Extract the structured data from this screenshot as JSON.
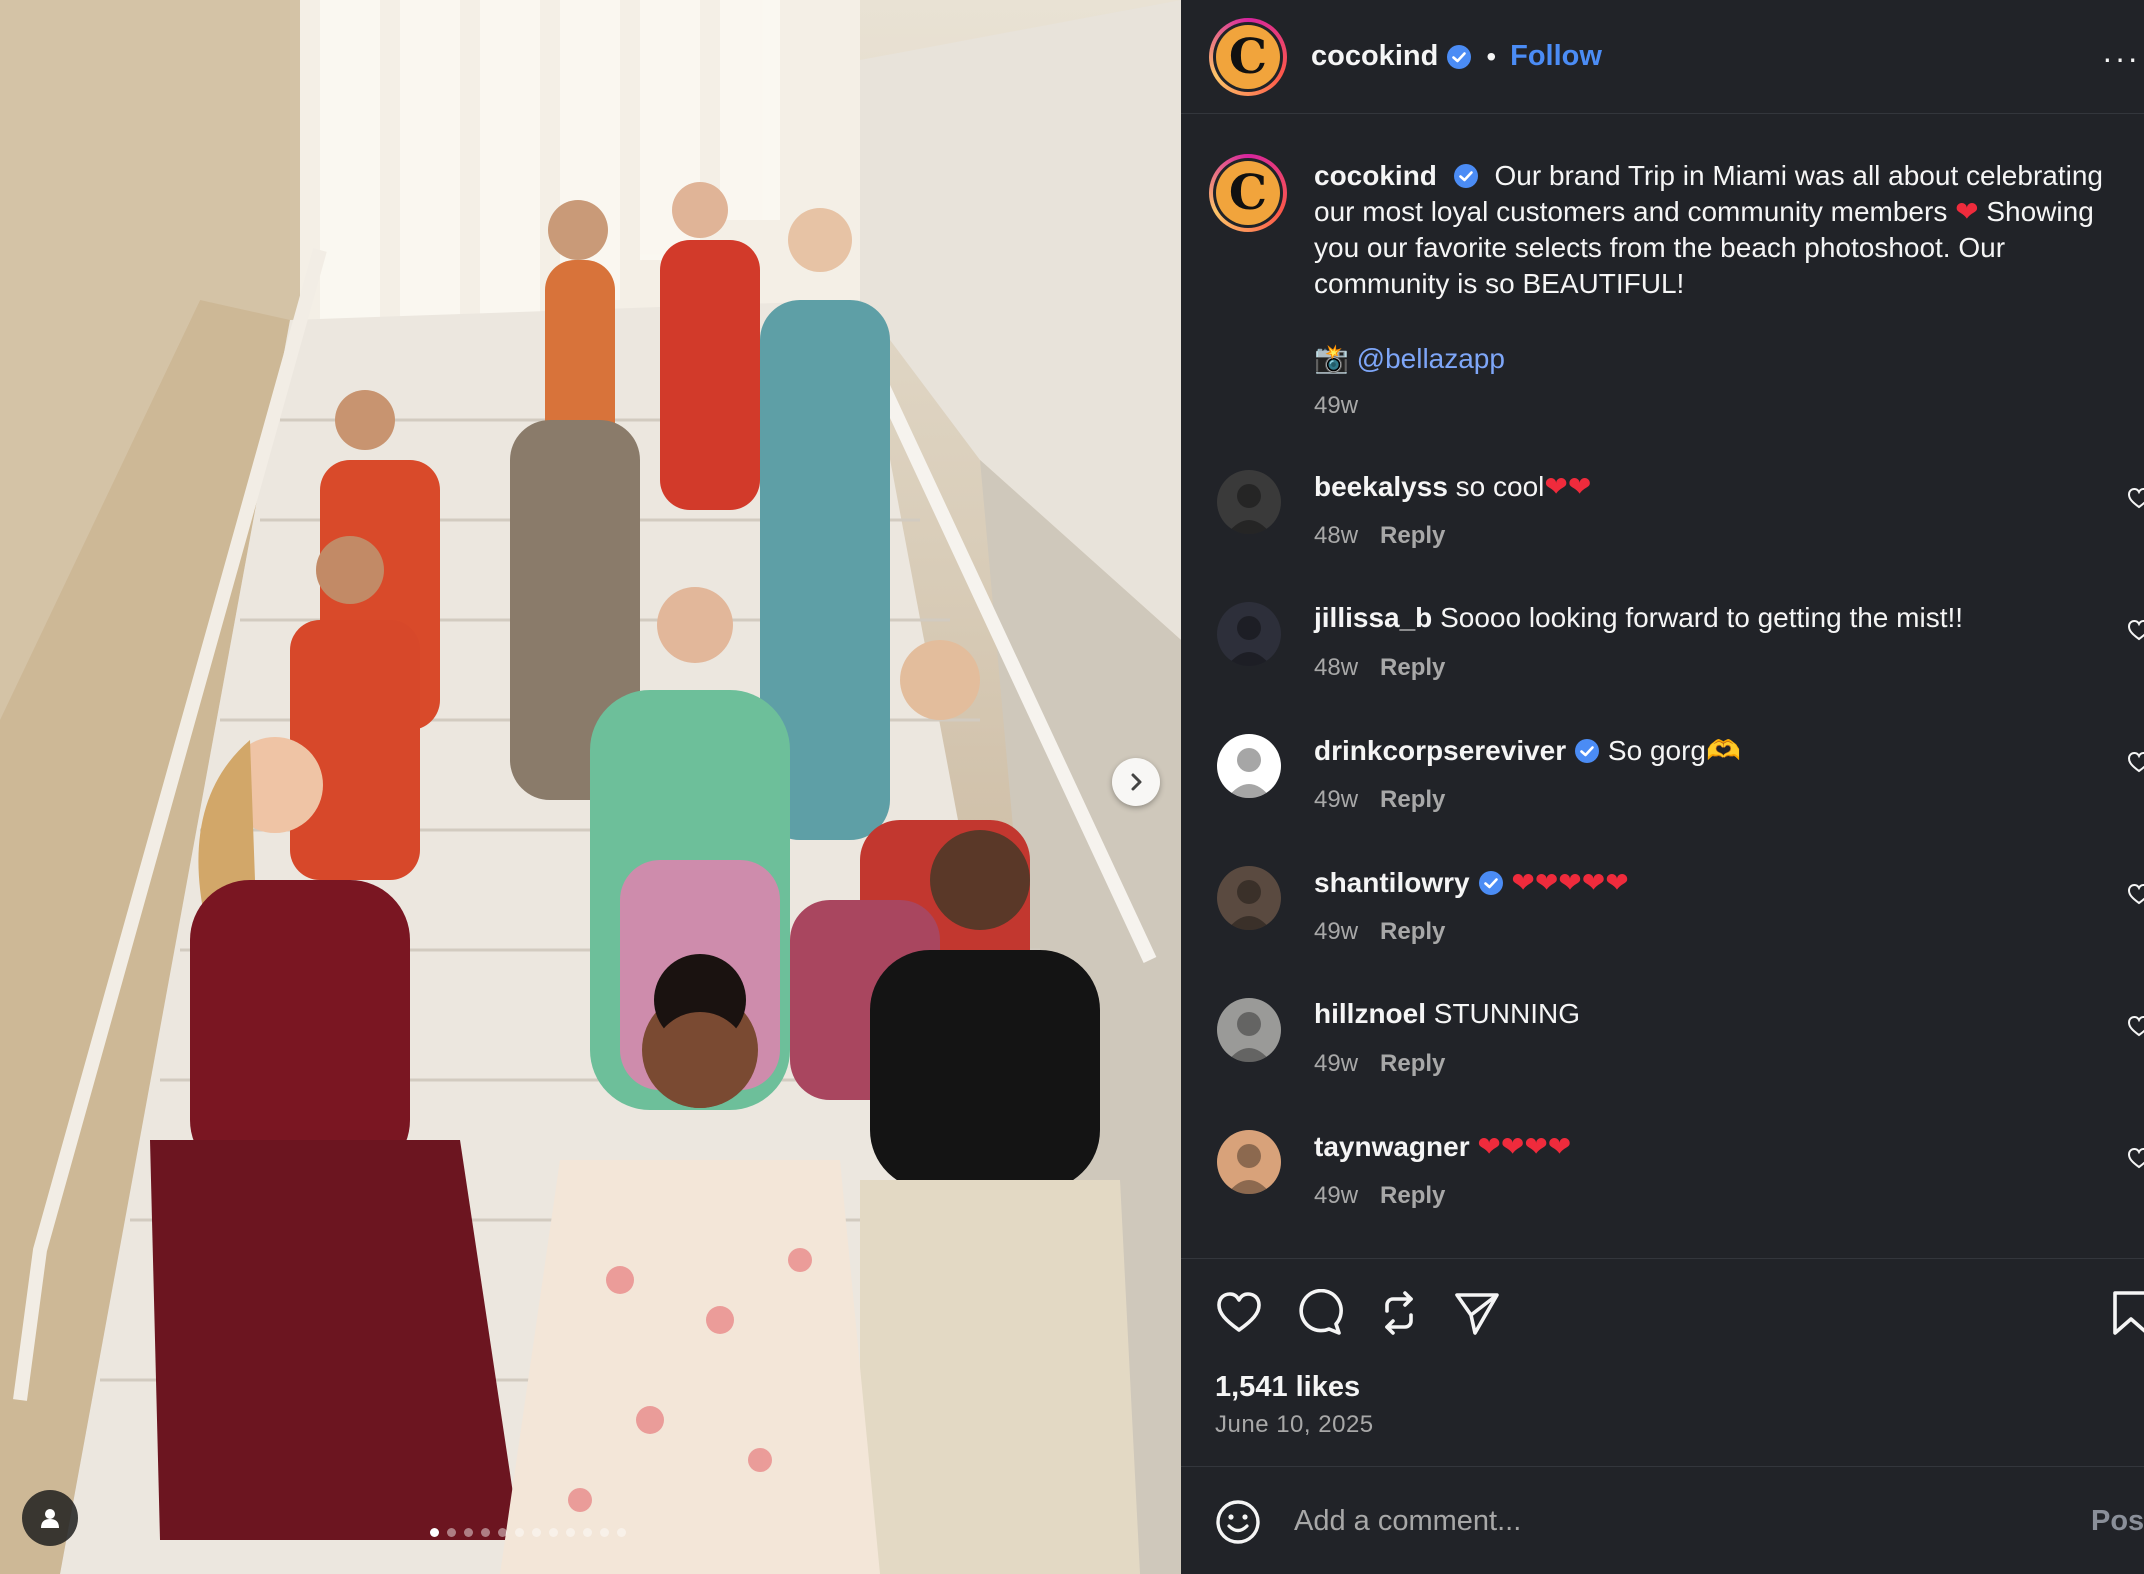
{
  "post": {
    "username": "cocokind",
    "avatar_letter": "C",
    "follow_label": "Follow",
    "separator": "•",
    "more_label": "···",
    "caption": {
      "username": "cocokind",
      "text": "Our brand Trip in Miami was all about celebrating our most loyal customers and community members",
      "text_after_heart": "Showing you our favorite selects from the beach photoshoot. Our community is so BEAUTIFUL!",
      "heart_emoji": "❤",
      "camera_emoji": "📸",
      "mention": "@bellazapp",
      "time": "49w"
    },
    "image": {
      "description_icon": "user-tag-icon",
      "carousel_dots": 12,
      "active_dot": 0
    }
  },
  "comments": [
    {
      "username": "beekalyss",
      "verified": false,
      "text": "so cool",
      "emoji": "❤❤",
      "time": "48w",
      "reply": "Reply",
      "avatar_color": "#3a3a3a"
    },
    {
      "username": "jillissa_b",
      "verified": false,
      "text": "Soooo looking forward to getting the mist!!",
      "emoji": "",
      "time": "48w",
      "reply": "Reply",
      "avatar_color": "#2d2f3a"
    },
    {
      "username": "drinkcorpsereviver",
      "verified": true,
      "text": "So gorg",
      "emoji": "🫶",
      "time": "49w",
      "reply": "Reply",
      "avatar_color": "#ffffff"
    },
    {
      "username": "shantilowry",
      "verified": true,
      "text": "",
      "emoji": "❤❤❤❤❤",
      "time": "49w",
      "reply": "Reply",
      "avatar_color": "#5a4a40"
    },
    {
      "username": "hillznoel",
      "verified": false,
      "text": "STUNNING",
      "emoji": "",
      "time": "49w",
      "reply": "Reply",
      "avatar_color": "#9a9a98"
    },
    {
      "username": "taynwagner",
      "verified": false,
      "text": "",
      "emoji": "❤❤❤❤",
      "time": "49w",
      "reply": "Reply",
      "avatar_color": "#d8a27a"
    }
  ],
  "footer": {
    "likes": "1,541 likes",
    "date": "June 10, 2025",
    "comment_placeholder": "Add a comment...",
    "post_label": "Post"
  },
  "colors": {
    "panel_bg": "#212328",
    "link_blue": "#4b8cf5",
    "mention_blue": "#7ea6f8",
    "muted": "#a8a8a8",
    "heart_red": "#ef2b3c",
    "avatar_orange": "#f1a43c"
  }
}
